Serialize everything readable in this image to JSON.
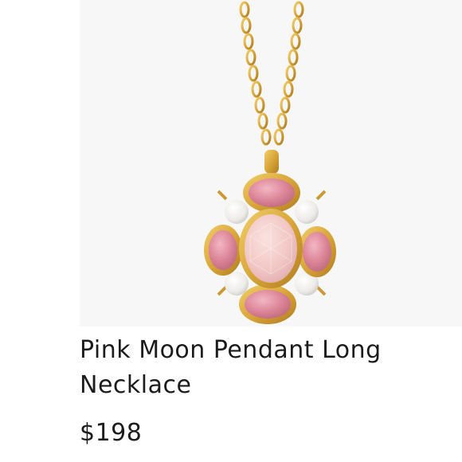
{
  "product": {
    "image_alt": "Pink Moon Pendant Long Necklace",
    "name": "Pink Moon Pendant Long Necklace",
    "price": "$198"
  },
  "colors": {
    "gold": "#d9a63a",
    "gold_dark": "#b07d1f",
    "pink_stone": "#d98294",
    "rose_quartz": "#f1c9c6",
    "pearl": "#f3f1ee",
    "photo_bg": "#f7f7f7",
    "text": "#1c1c1c"
  }
}
